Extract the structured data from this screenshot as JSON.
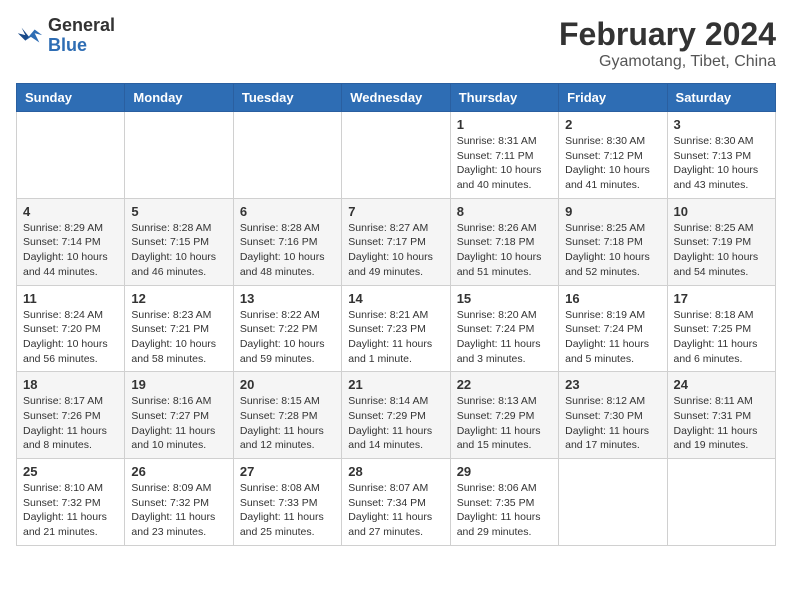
{
  "header": {
    "logo_general": "General",
    "logo_blue": "Blue",
    "month_year": "February 2024",
    "location": "Gyamotang, Tibet, China"
  },
  "weekdays": [
    "Sunday",
    "Monday",
    "Tuesday",
    "Wednesday",
    "Thursday",
    "Friday",
    "Saturday"
  ],
  "weeks": [
    [
      {
        "day": "",
        "info": ""
      },
      {
        "day": "",
        "info": ""
      },
      {
        "day": "",
        "info": ""
      },
      {
        "day": "",
        "info": ""
      },
      {
        "day": "1",
        "info": "Sunrise: 8:31 AM\nSunset: 7:11 PM\nDaylight: 10 hours\nand 40 minutes."
      },
      {
        "day": "2",
        "info": "Sunrise: 8:30 AM\nSunset: 7:12 PM\nDaylight: 10 hours\nand 41 minutes."
      },
      {
        "day": "3",
        "info": "Sunrise: 8:30 AM\nSunset: 7:13 PM\nDaylight: 10 hours\nand 43 minutes."
      }
    ],
    [
      {
        "day": "4",
        "info": "Sunrise: 8:29 AM\nSunset: 7:14 PM\nDaylight: 10 hours\nand 44 minutes."
      },
      {
        "day": "5",
        "info": "Sunrise: 8:28 AM\nSunset: 7:15 PM\nDaylight: 10 hours\nand 46 minutes."
      },
      {
        "day": "6",
        "info": "Sunrise: 8:28 AM\nSunset: 7:16 PM\nDaylight: 10 hours\nand 48 minutes."
      },
      {
        "day": "7",
        "info": "Sunrise: 8:27 AM\nSunset: 7:17 PM\nDaylight: 10 hours\nand 49 minutes."
      },
      {
        "day": "8",
        "info": "Sunrise: 8:26 AM\nSunset: 7:18 PM\nDaylight: 10 hours\nand 51 minutes."
      },
      {
        "day": "9",
        "info": "Sunrise: 8:25 AM\nSunset: 7:18 PM\nDaylight: 10 hours\nand 52 minutes."
      },
      {
        "day": "10",
        "info": "Sunrise: 8:25 AM\nSunset: 7:19 PM\nDaylight: 10 hours\nand 54 minutes."
      }
    ],
    [
      {
        "day": "11",
        "info": "Sunrise: 8:24 AM\nSunset: 7:20 PM\nDaylight: 10 hours\nand 56 minutes."
      },
      {
        "day": "12",
        "info": "Sunrise: 8:23 AM\nSunset: 7:21 PM\nDaylight: 10 hours\nand 58 minutes."
      },
      {
        "day": "13",
        "info": "Sunrise: 8:22 AM\nSunset: 7:22 PM\nDaylight: 10 hours\nand 59 minutes."
      },
      {
        "day": "14",
        "info": "Sunrise: 8:21 AM\nSunset: 7:23 PM\nDaylight: 11 hours\nand 1 minute."
      },
      {
        "day": "15",
        "info": "Sunrise: 8:20 AM\nSunset: 7:24 PM\nDaylight: 11 hours\nand 3 minutes."
      },
      {
        "day": "16",
        "info": "Sunrise: 8:19 AM\nSunset: 7:24 PM\nDaylight: 11 hours\nand 5 minutes."
      },
      {
        "day": "17",
        "info": "Sunrise: 8:18 AM\nSunset: 7:25 PM\nDaylight: 11 hours\nand 6 minutes."
      }
    ],
    [
      {
        "day": "18",
        "info": "Sunrise: 8:17 AM\nSunset: 7:26 PM\nDaylight: 11 hours\nand 8 minutes."
      },
      {
        "day": "19",
        "info": "Sunrise: 8:16 AM\nSunset: 7:27 PM\nDaylight: 11 hours\nand 10 minutes."
      },
      {
        "day": "20",
        "info": "Sunrise: 8:15 AM\nSunset: 7:28 PM\nDaylight: 11 hours\nand 12 minutes."
      },
      {
        "day": "21",
        "info": "Sunrise: 8:14 AM\nSunset: 7:29 PM\nDaylight: 11 hours\nand 14 minutes."
      },
      {
        "day": "22",
        "info": "Sunrise: 8:13 AM\nSunset: 7:29 PM\nDaylight: 11 hours\nand 15 minutes."
      },
      {
        "day": "23",
        "info": "Sunrise: 8:12 AM\nSunset: 7:30 PM\nDaylight: 11 hours\nand 17 minutes."
      },
      {
        "day": "24",
        "info": "Sunrise: 8:11 AM\nSunset: 7:31 PM\nDaylight: 11 hours\nand 19 minutes."
      }
    ],
    [
      {
        "day": "25",
        "info": "Sunrise: 8:10 AM\nSunset: 7:32 PM\nDaylight: 11 hours\nand 21 minutes."
      },
      {
        "day": "26",
        "info": "Sunrise: 8:09 AM\nSunset: 7:32 PM\nDaylight: 11 hours\nand 23 minutes."
      },
      {
        "day": "27",
        "info": "Sunrise: 8:08 AM\nSunset: 7:33 PM\nDaylight: 11 hours\nand 25 minutes."
      },
      {
        "day": "28",
        "info": "Sunrise: 8:07 AM\nSunset: 7:34 PM\nDaylight: 11 hours\nand 27 minutes."
      },
      {
        "day": "29",
        "info": "Sunrise: 8:06 AM\nSunset: 7:35 PM\nDaylight: 11 hours\nand 29 minutes."
      },
      {
        "day": "",
        "info": ""
      },
      {
        "day": "",
        "info": ""
      }
    ]
  ]
}
